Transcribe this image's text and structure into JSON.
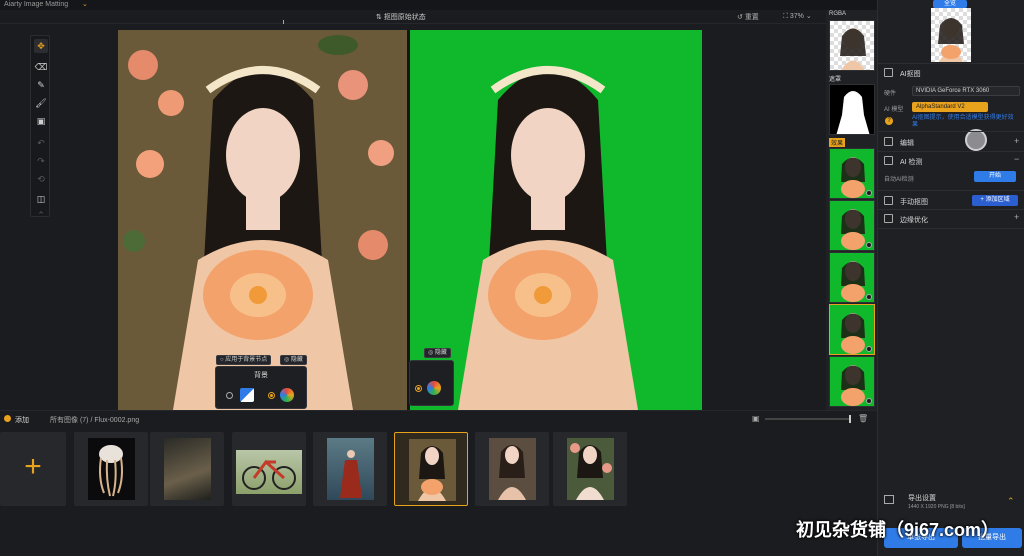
{
  "app": {
    "title": "Aiarty Image Matting"
  },
  "topbar": {
    "state_label": "抠图原始状态",
    "reset_label": "重置",
    "zoom": "37%"
  },
  "canvas_popups": {
    "background_title": "背景",
    "keep_edge_label": "应用于背景节点",
    "hide_label": "隐藏",
    "hide_label_2": "隐藏"
  },
  "strip": {
    "rgba_label": "RGBA",
    "mask_label": "遮罩",
    "effects_label": "效果"
  },
  "right_panel": {
    "top_button": "全览",
    "ai_matting": "AI抠图",
    "device_label": "硬件",
    "device_value": "NVIDIA GeForce RTX 3060",
    "model_label": "AI 模型",
    "model_value": "AlphaStandard V2",
    "hint_text": "AI抠图提示，使用合适模型获得更好效果",
    "edit_label": "编辑",
    "ai_detect": "AI 检测",
    "auto_detect_label": "自动AI检测",
    "start_label": "开始",
    "manual_matting": "手动抠图",
    "add_area": "+ 添加区域",
    "edge_opt": "边缘优化",
    "export_settings": "导出设置",
    "export_info": "1440 X 1920   PNG   [8 bits]",
    "export_single": "单张导出",
    "export_batch": "批量导出"
  },
  "bottombar": {
    "add_label": "添加",
    "all_images": "所有图像 (7)",
    "separator": "/",
    "current_file": "Flux-0002.png"
  },
  "gallery": {
    "add_symbol": "+",
    "items": [
      "jellyfish",
      "forest-rock",
      "bicycle",
      "woman-red-dress",
      "woman-flower-1",
      "woman-flower-2",
      "woman-flower-3"
    ]
  },
  "watermark": "初见杂货铺（9i67.com）",
  "colors": {
    "accent": "#e8a21c",
    "blue": "#2f7ce8",
    "green": "#10b92b"
  }
}
